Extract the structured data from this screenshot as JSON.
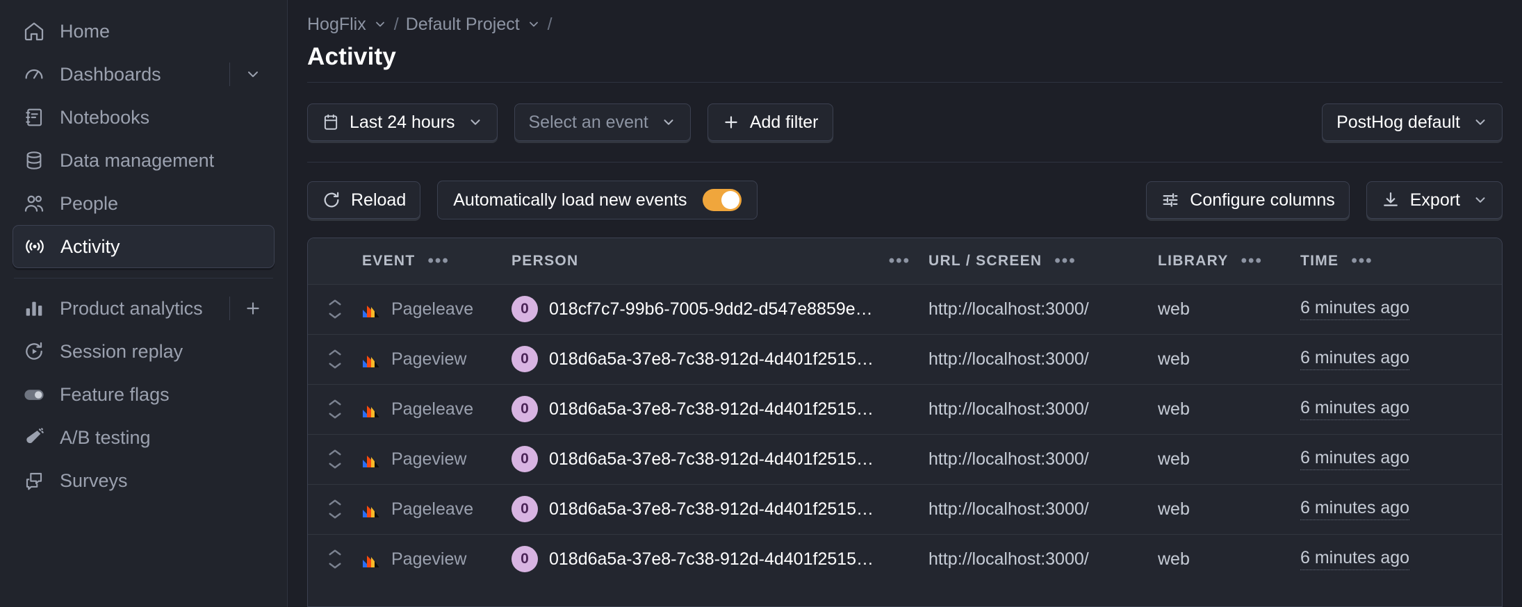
{
  "sidebar": {
    "items": [
      {
        "label": "Home",
        "icon": "home-icon",
        "active": false,
        "tail": "none"
      },
      {
        "label": "Dashboards",
        "icon": "dashboard-gauge-icon",
        "active": false,
        "tail": "chevron"
      },
      {
        "label": "Notebooks",
        "icon": "notebook-icon",
        "active": false,
        "tail": "none"
      },
      {
        "label": "Data management",
        "icon": "database-icon",
        "active": false,
        "tail": "none"
      },
      {
        "label": "People",
        "icon": "people-icon",
        "active": false,
        "tail": "none"
      },
      {
        "label": "Activity",
        "icon": "activity-broadcast-icon",
        "active": true,
        "tail": "none"
      }
    ],
    "items2": [
      {
        "label": "Product analytics",
        "icon": "bar-chart-icon",
        "active": false,
        "tail": "plus"
      },
      {
        "label": "Session replay",
        "icon": "replay-icon",
        "active": false,
        "tail": "none"
      },
      {
        "label": "Feature flags",
        "icon": "toggle-icon",
        "active": false,
        "tail": "none"
      },
      {
        "label": "A/B testing",
        "icon": "flask-icon",
        "active": false,
        "tail": "none"
      },
      {
        "label": "Surveys",
        "icon": "speech-bubbles-icon",
        "active": false,
        "tail": "none"
      }
    ]
  },
  "breadcrumb": {
    "org": "HogFlix",
    "project": "Default Project",
    "sep": "/",
    "trailing_sep": "/"
  },
  "header": {
    "title": "Activity"
  },
  "filters": {
    "date_range": "Last 24 hours",
    "event_placeholder": "Select an event",
    "add_filter": "Add filter",
    "plus": "+",
    "data_source": "PostHog default"
  },
  "toolbar": {
    "reload": "Reload",
    "auto_load_label": "Automatically load new events",
    "auto_load_on": true,
    "configure_columns": "Configure columns",
    "export": "Export"
  },
  "table": {
    "columns": [
      {
        "key": "sort",
        "label": "",
        "menu": false
      },
      {
        "key": "event",
        "label": "EVENT",
        "menu": true
      },
      {
        "key": "person",
        "label": "PERSON",
        "menu": true
      },
      {
        "key": "url",
        "label": "URL / SCREEN",
        "menu": true
      },
      {
        "key": "lib",
        "label": "LIBRARY",
        "menu": true
      },
      {
        "key": "time",
        "label": "TIME",
        "menu": true
      }
    ],
    "menu_glyph": "•••",
    "rows": [
      {
        "event": "Pageleave",
        "person_badge": "0",
        "person": "018cf7c7-99b6-7005-9dd2-d547e8859e…",
        "url": "http://localhost:3000/",
        "library": "web",
        "time": "6 minutes ago"
      },
      {
        "event": "Pageview",
        "person_badge": "0",
        "person": "018d6a5a-37e8-7c38-912d-4d401f2515…",
        "url": "http://localhost:3000/",
        "library": "web",
        "time": "6 minutes ago"
      },
      {
        "event": "Pageleave",
        "person_badge": "0",
        "person": "018d6a5a-37e8-7c38-912d-4d401f2515…",
        "url": "http://localhost:3000/",
        "library": "web",
        "time": "6 minutes ago"
      },
      {
        "event": "Pageview",
        "person_badge": "0",
        "person": "018d6a5a-37e8-7c38-912d-4d401f2515…",
        "url": "http://localhost:3000/",
        "library": "web",
        "time": "6 minutes ago"
      },
      {
        "event": "Pageleave",
        "person_badge": "0",
        "person": "018d6a5a-37e8-7c38-912d-4d401f2515…",
        "url": "http://localhost:3000/",
        "library": "web",
        "time": "6 minutes ago"
      },
      {
        "event": "Pageview",
        "person_badge": "0",
        "person": "018d6a5a-37e8-7c38-912d-4d401f2515…",
        "url": "http://localhost:3000/",
        "library": "web",
        "time": "6 minutes ago"
      }
    ]
  },
  "colors": {
    "accent_orange": "#f0a63c",
    "avatar_bg": "#d8b4e2",
    "panel": "#23262f",
    "page_bg": "#1d1f27",
    "sidebar_bg": "#21242c",
    "border": "#3c4151"
  }
}
